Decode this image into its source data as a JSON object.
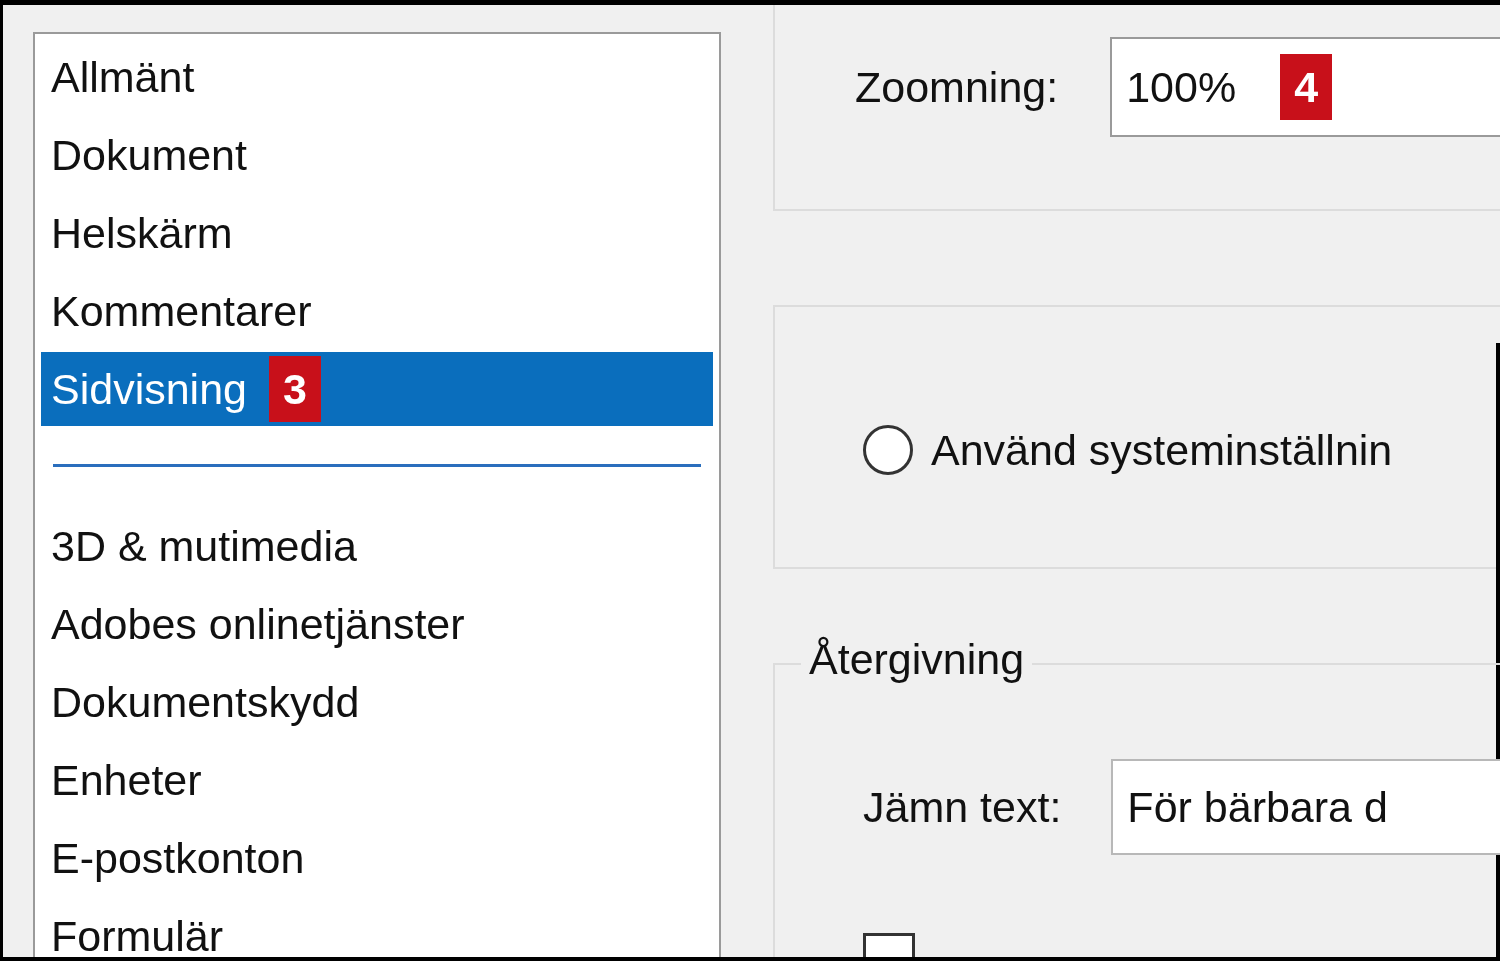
{
  "sidebar": {
    "groups": [
      {
        "items": [
          {
            "label": "Allmänt",
            "selected": false
          },
          {
            "label": "Dokument",
            "selected": false
          },
          {
            "label": "Helskärm",
            "selected": false
          },
          {
            "label": "Kommentarer",
            "selected": false
          },
          {
            "label": "Sidvisning",
            "selected": true,
            "badge": "3"
          }
        ]
      },
      {
        "items": [
          {
            "label": "3D & mutimedia",
            "selected": false
          },
          {
            "label": "Adobes onlinetjänster",
            "selected": false
          },
          {
            "label": "Dokumentskydd",
            "selected": false
          },
          {
            "label": "Enheter",
            "selected": false
          },
          {
            "label": "E-postkonton",
            "selected": false
          },
          {
            "label": "Formulär",
            "selected": false
          }
        ]
      }
    ]
  },
  "zoom": {
    "label": "Zoomning:",
    "value": "100%",
    "badge": "4"
  },
  "resolution": {
    "radio": {
      "label": "Använd systeminställnin",
      "selected": false
    }
  },
  "rendering": {
    "title": "Återgivning",
    "smooth_text": {
      "label": "Jämn text:",
      "value": "För bärbara d"
    },
    "checkbox": {
      "checked": false
    }
  }
}
